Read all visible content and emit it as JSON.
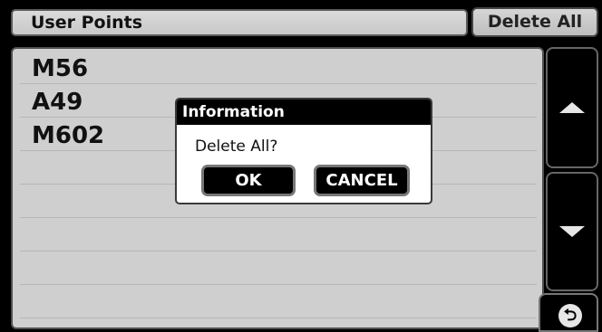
{
  "header": {
    "title": "User Points",
    "delete_all_label": "Delete All"
  },
  "list": {
    "items": [
      {
        "label": "M56"
      },
      {
        "label": "A49"
      },
      {
        "label": "M602"
      }
    ]
  },
  "controls": {
    "scroll_up_icon": "up-arrow-icon",
    "scroll_down_icon": "down-arrow-icon",
    "back_icon": "back-icon",
    "back_glyph": "⮌"
  },
  "dialog": {
    "title": "Information",
    "message": "Delete All?",
    "ok_label": "OK",
    "cancel_label": "CANCEL"
  }
}
